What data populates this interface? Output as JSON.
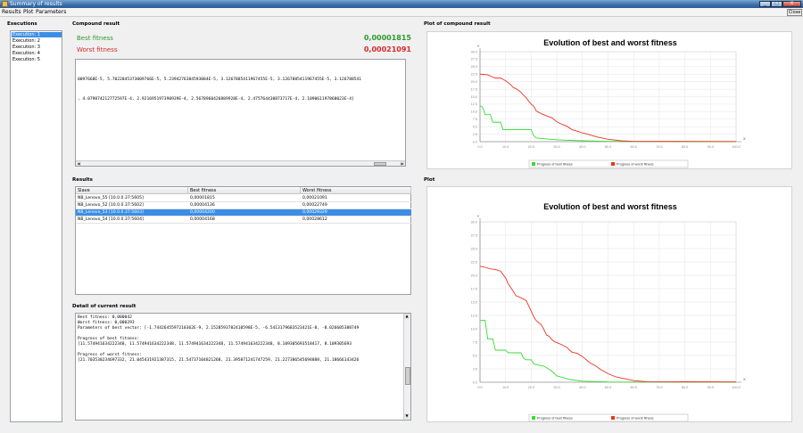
{
  "window": {
    "title": "Summary of results",
    "min_label": "_",
    "max_label": "□",
    "close_label": "X"
  },
  "menubar": {
    "items": [
      "Results",
      "Plot",
      "Parameters"
    ],
    "close_label": "Close"
  },
  "executions": {
    "title": "Executions",
    "items": [
      "Execution: 1",
      "Execution: 2",
      "Execution: 3",
      "Execution: 4",
      "Execution: 5"
    ],
    "selected": 0
  },
  "compound": {
    "title": "Compound result",
    "best_label": "Best fitness",
    "best_value": "0,00001815",
    "worst_label": "Worst fitness",
    "worst_value": "0,00021091",
    "line1": "0097668E-5, 5.7022045373009766E-5, 5.2394276384593084E-5, 3.1267885411967455E-5, 3.1267885411967455E-5, 3.126788541",
    "line2": ", 4.079074212772597E-4, 2.921695197390939E-4, 2.5678960426889928E-4, 2.475764430873717E-4, 2.109061197868023E-4]",
    "best_color": "#2e9a2e",
    "worst_color": "#d42a2a"
  },
  "results": {
    "title": "Results",
    "columns": [
      "Slave",
      "Best fitness",
      "Worst fitness"
    ],
    "rows": [
      [
        "NB_Lenovo_55 [10.0.0.37:5605]",
        "0,00001815",
        "0,00021091"
      ],
      [
        "NB_Lenovo_52 [10.0.0.37:5602]",
        "0,00004136",
        "0,00022749"
      ],
      [
        "NB_Lenovo_53 [10.0.0.37:5603]",
        "0,00004200",
        "0,00029329"
      ],
      [
        "NB_Lenovo_54 [10.0.0.37:5604]",
        "0,00004168",
        "0,00028612"
      ]
    ],
    "selected": 2
  },
  "detail": {
    "title": "Detail of current result",
    "lines": [
      "Best fitness: 0,000042",
      "Worst fitness: 0,000293",
      "Parameters of best vector: [-1.7442645597210362E-9, 2.1528593782410598E-5, -6.5413179683523421E-8, -8.026605388749",
      "",
      "Progress of best fitness:",
      "[11.574941634222348, 11.574941634222348, 11.574941634222348, 11.574941634222348, 8.109305693518417, 8.109305693",
      "",
      "Progress of worst fitness:",
      "[21.703530234697332, 21.045431921387315, 21.54737104821268, 21.395871241747259, 21.227386545694888, 21.18666143426"
    ]
  },
  "plot_compound_title": "Plot of compound result",
  "plot_title": "Plot",
  "chart_data": [
    {
      "type": "line",
      "title": "Evolution of best and worst fitness",
      "ylabel": "Y",
      "xlabel": "X",
      "xlim": [
        0,
        100
      ],
      "ylim": [
        0,
        30
      ],
      "xticks": [
        "0.0",
        "10.0",
        "20.0",
        "30.0",
        "40.0",
        "50.0",
        "60.0",
        "70.0",
        "80.0",
        "90.0",
        "100.0"
      ],
      "yticks": [
        "0.0",
        "2.5",
        "5.0",
        "7.5",
        "10.0",
        "12.5",
        "15.0",
        "17.5",
        "20.0",
        "22.5",
        "25.0",
        "27.5",
        "30.0"
      ],
      "grid": true,
      "legend_position": "bottom",
      "series": [
        {
          "name": "Progress of best fitness",
          "color": "#33dd33",
          "points": [
            [
              0,
              12
            ],
            [
              1,
              11.5
            ],
            [
              2,
              9
            ],
            [
              4,
              9
            ],
            [
              5,
              6.5
            ],
            [
              8,
              6.5
            ],
            [
              9,
              4
            ],
            [
              20,
              4
            ],
            [
              21,
              2
            ],
            [
              22,
              1.2
            ],
            [
              30,
              0.6
            ],
            [
              40,
              0.3
            ],
            [
              50,
              0.1
            ],
            [
              60,
              0.05
            ],
            [
              100,
              0.02
            ]
          ]
        },
        {
          "name": "Progress of worst fitness",
          "color": "#ee3322",
          "points": [
            [
              0,
              22.5
            ],
            [
              3,
              22.3
            ],
            [
              4,
              21.9
            ],
            [
              6,
              21.2
            ],
            [
              8,
              21.2
            ],
            [
              10,
              20.3
            ],
            [
              12,
              19
            ],
            [
              13,
              18
            ],
            [
              14,
              17.7
            ],
            [
              16,
              16.5
            ],
            [
              17,
              15.5
            ],
            [
              18,
              14.7
            ],
            [
              19,
              13.5
            ],
            [
              20,
              12.5
            ],
            [
              21,
              11.8
            ],
            [
              22,
              10.2
            ],
            [
              24,
              9.3
            ],
            [
              26,
              8.6
            ],
            [
              28,
              8
            ],
            [
              30,
              6.6
            ],
            [
              32,
              5.8
            ],
            [
              34,
              5.1
            ],
            [
              36,
              4
            ],
            [
              38,
              3.5
            ],
            [
              40,
              2.9
            ],
            [
              42,
              2.5
            ],
            [
              44,
              2
            ],
            [
              46,
              1.5
            ],
            [
              50,
              0.8
            ],
            [
              55,
              0.3
            ],
            [
              60,
              0.1
            ],
            [
              100,
              0.05
            ]
          ]
        }
      ]
    },
    {
      "type": "line",
      "title": "Evolution of best and worst fitness",
      "ylabel": "Y",
      "xlabel": "X",
      "xlim": [
        0,
        100
      ],
      "ylim": [
        0,
        30
      ],
      "xticks": [
        "0.0",
        "10.0",
        "20.0",
        "30.0",
        "40.0",
        "50.0",
        "60.0",
        "70.0",
        "80.0",
        "90.0",
        "100.0"
      ],
      "yticks": [
        "0.0",
        "2.5",
        "5.0",
        "7.5",
        "10.0",
        "12.5",
        "15.0",
        "17.5",
        "20.0",
        "22.5",
        "25.0",
        "27.5",
        "30.0"
      ],
      "grid": true,
      "legend_position": "bottom",
      "series": [
        {
          "name": "Progress of best fitness",
          "color": "#33dd33",
          "points": [
            [
              0,
              11.6
            ],
            [
              2,
              11.6
            ],
            [
              3,
              8.1
            ],
            [
              5,
              8.1
            ],
            [
              6,
              6
            ],
            [
              10,
              6
            ],
            [
              11,
              5.5
            ],
            [
              16,
              5.5
            ],
            [
              17,
              4.5
            ],
            [
              18,
              4.2
            ],
            [
              20,
              4.2
            ],
            [
              21,
              3.4
            ],
            [
              23,
              3.2
            ],
            [
              25,
              3
            ],
            [
              28,
              2.1
            ],
            [
              30,
              1.2
            ],
            [
              35,
              0.5
            ],
            [
              40,
              0.2
            ],
            [
              50,
              0.05
            ],
            [
              100,
              0.02
            ]
          ]
        },
        {
          "name": "Progress of worst fitness",
          "color": "#ee3322",
          "points": [
            [
              0,
              21.7
            ],
            [
              2,
              21.5
            ],
            [
              4,
              21.2
            ],
            [
              6,
              21.1
            ],
            [
              8,
              20.8
            ],
            [
              10,
              19.5
            ],
            [
              11,
              18.4
            ],
            [
              12,
              17.7
            ],
            [
              13,
              17
            ],
            [
              14,
              16.2
            ],
            [
              16,
              15.8
            ],
            [
              18,
              15.3
            ],
            [
              20,
              13.3
            ],
            [
              21,
              12.2
            ],
            [
              22,
              11.5
            ],
            [
              24,
              10.7
            ],
            [
              25,
              9.8
            ],
            [
              26,
              8.8
            ],
            [
              27,
              8.6
            ],
            [
              28,
              8
            ],
            [
              29,
              7.6
            ],
            [
              30,
              7.4
            ],
            [
              32,
              7
            ],
            [
              34,
              6.5
            ],
            [
              35,
              6
            ],
            [
              36,
              5.6
            ],
            [
              38,
              5.4
            ],
            [
              40,
              4.8
            ],
            [
              42,
              4
            ],
            [
              43,
              3.6
            ],
            [
              45,
              3.1
            ],
            [
              47,
              2.4
            ],
            [
              50,
              1.6
            ],
            [
              53,
              1
            ],
            [
              56,
              0.7
            ],
            [
              60,
              0.3
            ],
            [
              65,
              0.1
            ],
            [
              100,
              0.05
            ]
          ]
        }
      ]
    }
  ]
}
